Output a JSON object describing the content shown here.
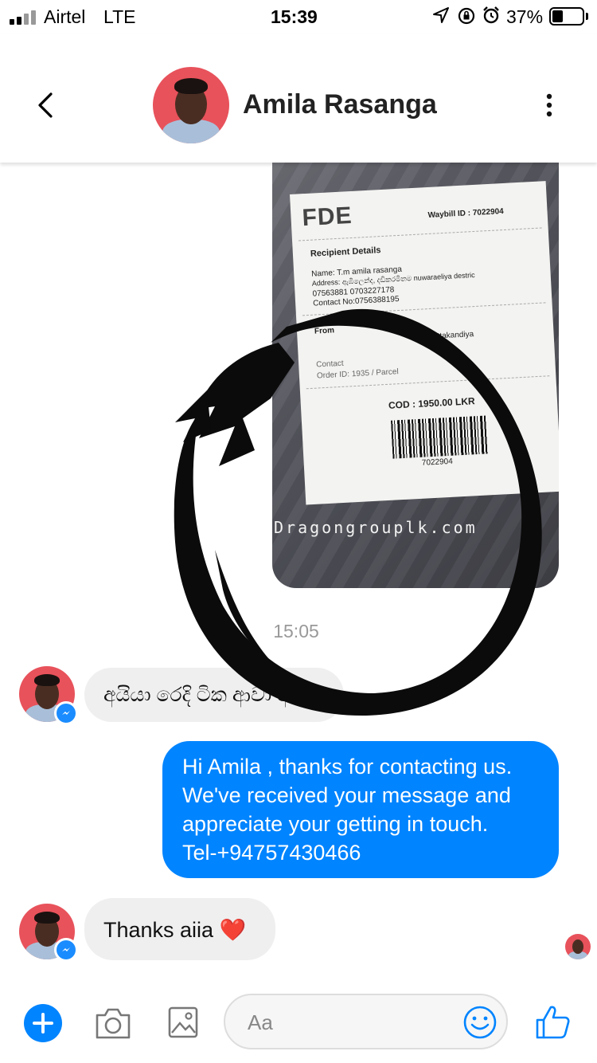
{
  "status_bar": {
    "carrier": "Airtel",
    "network": "LTE",
    "time": "15:39",
    "battery_percent": "37%",
    "battery_level": 0.37
  },
  "header": {
    "contact_name": "Amila Rasanga",
    "back_icon": "chevron-left-icon",
    "menu_icon": "more-vertical-icon"
  },
  "photo_message": {
    "brand": "FDE",
    "waybill": "Waybill ID : 7022904",
    "recipient_heading": "Recipient Details",
    "name_line": "Name: T.m amila rasanga",
    "address_line": "Address: ඇඹිලෙන්ද, දඩිකරමිනම nuwaraeliya destric",
    "phone_line1": "07563881  0703227178",
    "phone_line2": "Contact No:0756388195",
    "from_label": "From",
    "from_address": "Dehiattakandiya",
    "contact_label": "Contact",
    "order_line": "Order ID: 1935 / Parcel",
    "cod": "COD : 1950.00 LKR",
    "barcode_number": "7022904",
    "watermark": "Dragongrouplk.com"
  },
  "timestamp": "15:05",
  "messages": [
    {
      "from": "contact",
      "text": "අයියා රෙදි ටික ආවා අයියා"
    },
    {
      "from": "me",
      "lines": [
        "Hi Amila , thanks for contacting us.",
        "We've received your message and",
        "appreciate your getting in touch.",
        "Tel-+94757430466"
      ]
    },
    {
      "from": "contact",
      "text": "Thanks aiia ❤️"
    }
  ],
  "composer": {
    "placeholder": "Aa",
    "plus_icon": "plus-icon",
    "camera_icon": "camera-icon",
    "gallery_icon": "image-icon",
    "emoji_icon": "smiley-icon",
    "like_icon": "thumbs-up-icon"
  },
  "colors": {
    "accent": "#0084ff",
    "incoming_bubble": "#efefef",
    "avatar_bg": "#e8525b"
  }
}
